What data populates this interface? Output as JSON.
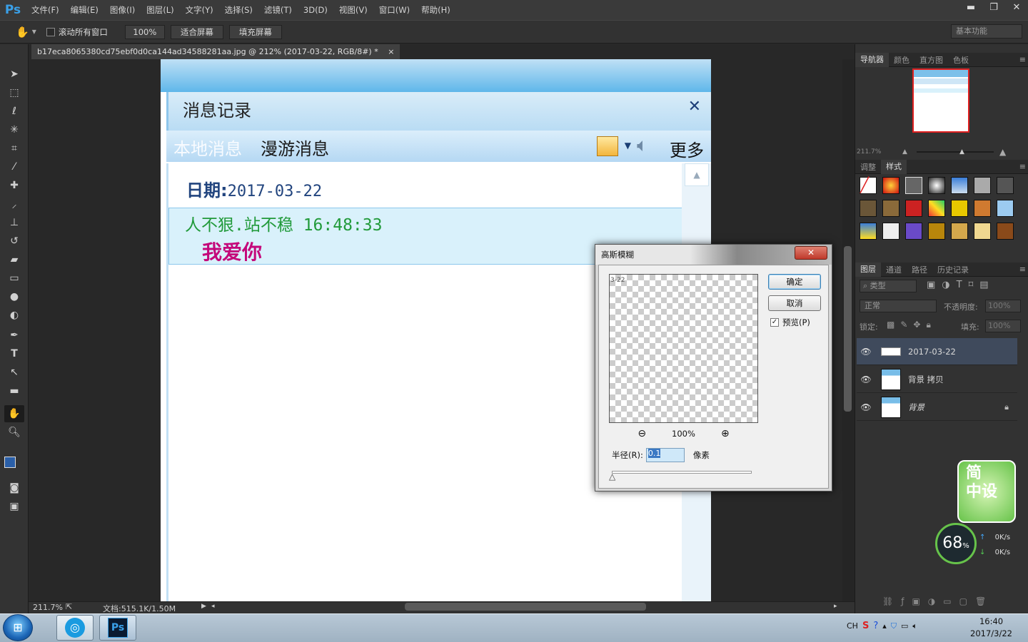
{
  "app": {
    "logo": "Ps"
  },
  "menu": [
    "文件(F)",
    "编辑(E)",
    "图像(I)",
    "图层(L)",
    "文字(Y)",
    "选择(S)",
    "滤镜(T)",
    "3D(D)",
    "视图(V)",
    "窗口(W)",
    "帮助(H)"
  ],
  "window_controls": {
    "minimize": "▬",
    "restore": "❐",
    "close": "✕"
  },
  "options": {
    "scroll_all_label": "滚动所有窗口",
    "zoom_btn": "100%",
    "fit_btn": "适合屏幕",
    "fill_btn": "填充屏幕",
    "workspace": "基本功能"
  },
  "document": {
    "tab_title": "b17eca8065380cd75ebf0d0ca144ad34588281aa.jpg @ 212% (2017-03-22, RGB/8#) *",
    "tab_close": "×"
  },
  "image": {
    "title": "消息记录",
    "close": "✕",
    "tab_local": "本地消息",
    "tab_roam": "漫游消息",
    "more": "更多",
    "date_label": "日期:",
    "date_value": "2017-03-22",
    "sender": "人不狠.站不稳 16:48:33",
    "message": "我爱你"
  },
  "status": {
    "zoom": "211.7%",
    "doc_info": "文档:515.1K/1.50M"
  },
  "navigator": {
    "tabs": [
      "导航器",
      "颜色",
      "直方图",
      "色板"
    ],
    "zoom": "211.7%"
  },
  "adjust": {
    "tabs": [
      "调整",
      "样式"
    ]
  },
  "layers": {
    "tabs": [
      "图层",
      "通道",
      "路径",
      "历史记录"
    ],
    "filter_kind": "类型",
    "blend_mode": "正常",
    "opacity_label": "不透明度:",
    "opacity_value": "100%",
    "lock_label": "锁定:",
    "fill_label": "填充:",
    "fill_value": "100%",
    "items": [
      {
        "name": "2017-03-22",
        "selected": true
      },
      {
        "name": "背景 拷贝",
        "selected": false
      },
      {
        "name": "背景",
        "selected": false,
        "locked": true
      }
    ]
  },
  "dialog": {
    "title": "高斯模糊",
    "close": "✕",
    "ok": "确定",
    "cancel": "取消",
    "preview_label": "预览(P)",
    "preview_checked": true,
    "zoom": "100%",
    "preview_text": "3-22",
    "radius_label": "半径(R):",
    "radius_value": "0.1",
    "radius_unit": "像素"
  },
  "gadget": {
    "text1": "简",
    "text2": "中设",
    "percent": "68",
    "percent_unit": "%",
    "up": "0K/s",
    "down": "0K/s"
  },
  "taskbar": {
    "time": "16:40",
    "date": "2017/3/22",
    "ime": "CH",
    "ps_label": "Ps"
  }
}
